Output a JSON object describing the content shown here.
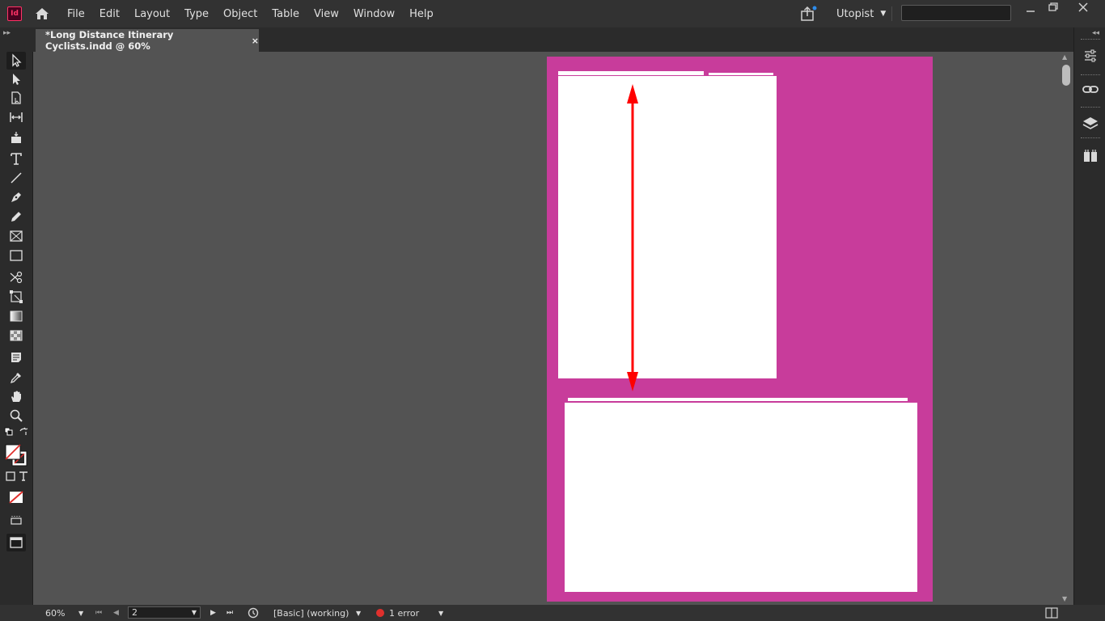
{
  "app": {
    "logo_text": "Id"
  },
  "menu": {
    "items": [
      "File",
      "Edit",
      "Layout",
      "Type",
      "Object",
      "Table",
      "View",
      "Window",
      "Help"
    ]
  },
  "workspace": {
    "name": "Utopist"
  },
  "search": {
    "placeholder": ""
  },
  "tabs": [
    {
      "label": "*Long Distance Itinerary Cyclists.indd @ 60%",
      "close": "×"
    }
  ],
  "status": {
    "zoom": "60%",
    "page": "2",
    "preflight_profile": "[Basic] (working)",
    "errors": "1 error"
  },
  "colors": {
    "page_background": "#c83c9b",
    "frame": "#ffffff",
    "arrow": "#ff0000",
    "error": "#e0302d"
  }
}
